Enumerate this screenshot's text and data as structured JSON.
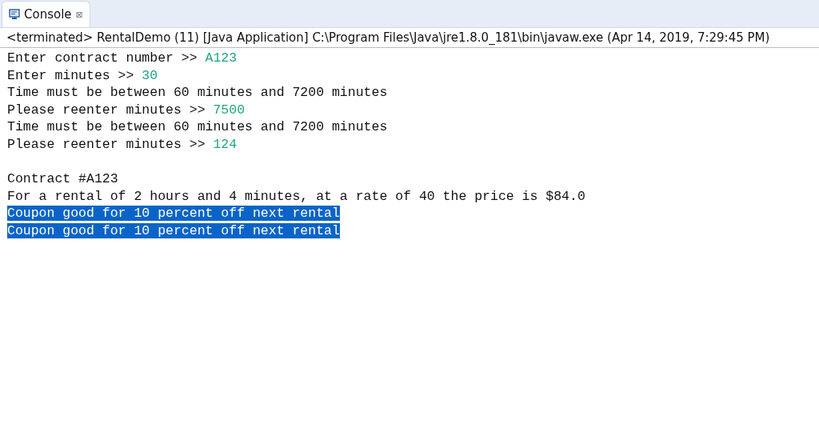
{
  "tab": {
    "label": "Console",
    "close": "⊠"
  },
  "status": "<terminated> RentalDemo (11) [Java Application] C:\\Program Files\\Java\\jre1.8.0_181\\bin\\javaw.exe (Apr 14, 2019, 7:29:45 PM)",
  "lines": [
    {
      "kind": "text",
      "text": "Enter contract number >> ",
      "input": "A123",
      "selected": false
    },
    {
      "kind": "text",
      "text": "Enter minutes >> ",
      "input": "30",
      "selected": false
    },
    {
      "kind": "text",
      "text": "Time must be between 60 minutes and 7200 minutes",
      "selected": false
    },
    {
      "kind": "text",
      "text": "Please reenter minutes >> ",
      "input": "7500",
      "selected": false
    },
    {
      "kind": "text",
      "text": "Time must be between 60 minutes and 7200 minutes",
      "selected": false
    },
    {
      "kind": "text",
      "text": "Please reenter minutes >> ",
      "input": "124",
      "selected": false
    },
    {
      "kind": "blank"
    },
    {
      "kind": "text",
      "text": "Contract #A123",
      "selected": false
    },
    {
      "kind": "text",
      "text": "For a rental of 2 hours and 4 minutes, at a rate of 40 the price is $84.0",
      "selected": false
    },
    {
      "kind": "text",
      "text": "Coupon good for 10 percent off next rental",
      "selected": true
    },
    {
      "kind": "text",
      "text": "Coupon good for 10 percent off next rental",
      "selected": true
    }
  ]
}
